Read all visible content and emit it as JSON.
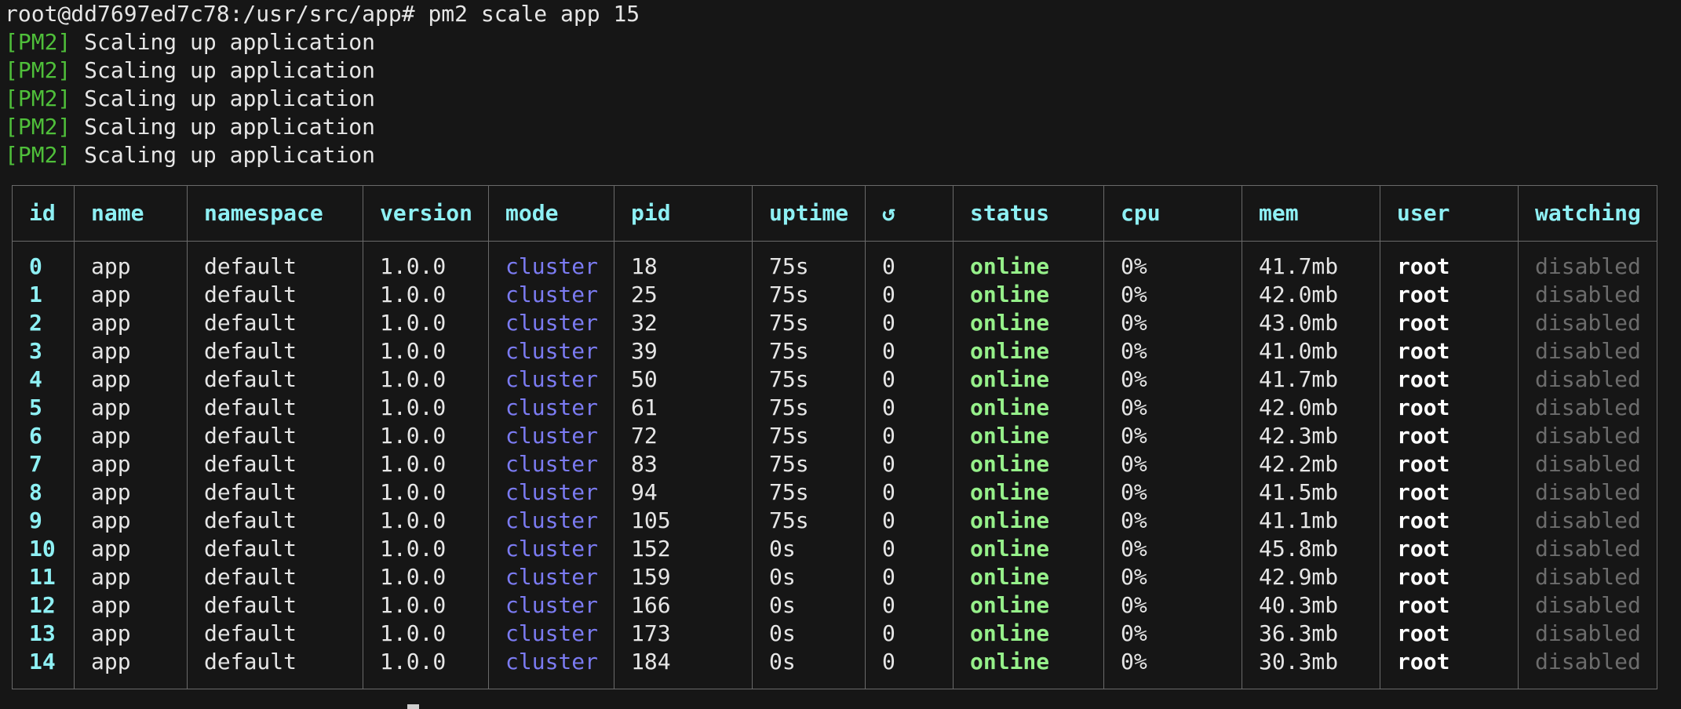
{
  "terminal": {
    "prompt_line": "root@dd7697ed7c78:/usr/src/app# pm2 scale app 15",
    "output_lines": [
      {
        "tag": "[PM2]",
        "text": " Scaling up application"
      },
      {
        "tag": "[PM2]",
        "text": " Scaling up application"
      },
      {
        "tag": "[PM2]",
        "text": " Scaling up application"
      },
      {
        "tag": "[PM2]",
        "text": " Scaling up application"
      },
      {
        "tag": "[PM2]",
        "text": " Scaling up application"
      }
    ]
  },
  "table": {
    "headers": [
      "id",
      "name",
      "namespace",
      "version",
      "mode",
      "pid",
      "uptime",
      "↺",
      "status",
      "cpu",
      "mem",
      "user",
      "watching"
    ],
    "rows": [
      [
        "0",
        "app",
        "default",
        "1.0.0",
        "cluster",
        "18",
        "75s",
        "0",
        "online",
        "0%",
        "41.7mb",
        "root",
        "disabled"
      ],
      [
        "1",
        "app",
        "default",
        "1.0.0",
        "cluster",
        "25",
        "75s",
        "0",
        "online",
        "0%",
        "42.0mb",
        "root",
        "disabled"
      ],
      [
        "2",
        "app",
        "default",
        "1.0.0",
        "cluster",
        "32",
        "75s",
        "0",
        "online",
        "0%",
        "43.0mb",
        "root",
        "disabled"
      ],
      [
        "3",
        "app",
        "default",
        "1.0.0",
        "cluster",
        "39",
        "75s",
        "0",
        "online",
        "0%",
        "41.0mb",
        "root",
        "disabled"
      ],
      [
        "4",
        "app",
        "default",
        "1.0.0",
        "cluster",
        "50",
        "75s",
        "0",
        "online",
        "0%",
        "41.7mb",
        "root",
        "disabled"
      ],
      [
        "5",
        "app",
        "default",
        "1.0.0",
        "cluster",
        "61",
        "75s",
        "0",
        "online",
        "0%",
        "42.0mb",
        "root",
        "disabled"
      ],
      [
        "6",
        "app",
        "default",
        "1.0.0",
        "cluster",
        "72",
        "75s",
        "0",
        "online",
        "0%",
        "42.3mb",
        "root",
        "disabled"
      ],
      [
        "7",
        "app",
        "default",
        "1.0.0",
        "cluster",
        "83",
        "75s",
        "0",
        "online",
        "0%",
        "42.2mb",
        "root",
        "disabled"
      ],
      [
        "8",
        "app",
        "default",
        "1.0.0",
        "cluster",
        "94",
        "75s",
        "0",
        "online",
        "0%",
        "41.5mb",
        "root",
        "disabled"
      ],
      [
        "9",
        "app",
        "default",
        "1.0.0",
        "cluster",
        "105",
        "75s",
        "0",
        "online",
        "0%",
        "41.1mb",
        "root",
        "disabled"
      ],
      [
        "10",
        "app",
        "default",
        "1.0.0",
        "cluster",
        "152",
        "0s",
        "0",
        "online",
        "0%",
        "45.8mb",
        "root",
        "disabled"
      ],
      [
        "11",
        "app",
        "default",
        "1.0.0",
        "cluster",
        "159",
        "0s",
        "0",
        "online",
        "0%",
        "42.9mb",
        "root",
        "disabled"
      ],
      [
        "12",
        "app",
        "default",
        "1.0.0",
        "cluster",
        "166",
        "0s",
        "0",
        "online",
        "0%",
        "40.3mb",
        "root",
        "disabled"
      ],
      [
        "13",
        "app",
        "default",
        "1.0.0",
        "cluster",
        "173",
        "0s",
        "0",
        "online",
        "0%",
        "36.3mb",
        "root",
        "disabled"
      ],
      [
        "14",
        "app",
        "default",
        "1.0.0",
        "cluster",
        "184",
        "0s",
        "0",
        "online",
        "0%",
        "30.3mb",
        "root",
        "disabled"
      ]
    ]
  },
  "colors": {
    "background": "#161616",
    "pm2_tag": "#4fbf3a",
    "header": "#8ef0f4",
    "mode": "#7b7bf2",
    "status_online": "#96f08a",
    "watching_disabled": "#6c6c6c",
    "border": "#6a6a6a"
  }
}
